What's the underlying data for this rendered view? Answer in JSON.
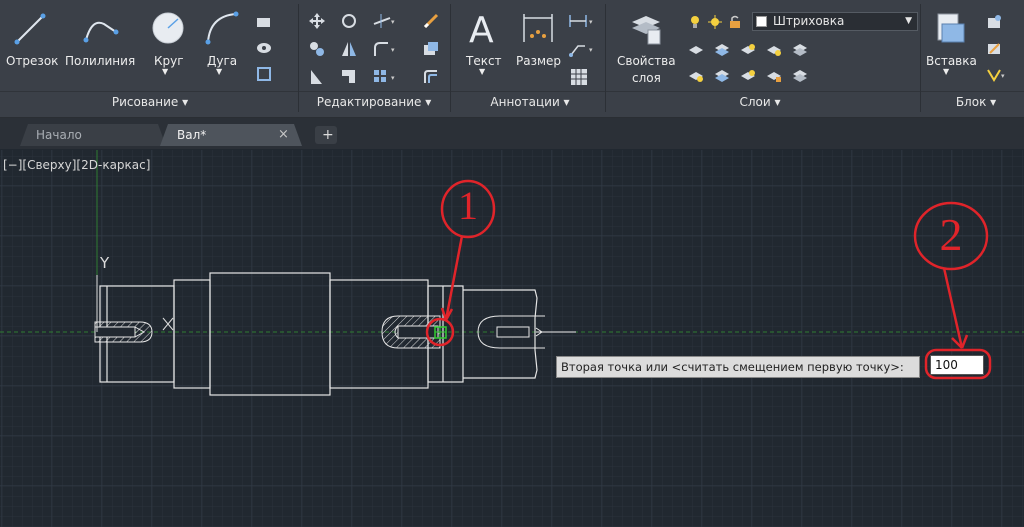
{
  "ribbon": {
    "draw": {
      "line": "Отрезок",
      "polyline": "Полилиния",
      "circle": "Круг",
      "arc": "Дуга",
      "panel": "Рисование ▾"
    },
    "modify": {
      "panel": "Редактирование ▾"
    },
    "annotation": {
      "text": "Текст",
      "dimension": "Размер",
      "panel": "Аннотации ▾"
    },
    "layers": {
      "properties_line1": "Свойства",
      "properties_line2": "слоя",
      "current_layer": "Штриховка",
      "panel": "Слои ▾"
    },
    "block": {
      "insert": "Вставка",
      "panel": "Блок ▾"
    }
  },
  "tabs": [
    {
      "label": "Начало"
    },
    {
      "label": "Вал*",
      "close": "×"
    }
  ],
  "new_tab": "+",
  "viewport": {
    "label": "[−][Сверху][2D-каркас]",
    "ucs_y": "Y",
    "ucs_x": "X"
  },
  "command": {
    "prompt": "Вторая точка или <считать смещением первую точку>:",
    "value": "100"
  },
  "annotations": {
    "marker1": "1",
    "marker2": "2"
  },
  "colors": {
    "ribbon_bg": "#3b4048",
    "canvas_bg": "#212830",
    "accent_red": "#e0242a",
    "snap_green": "#33cc33",
    "axis_green": "#2e7d32"
  }
}
